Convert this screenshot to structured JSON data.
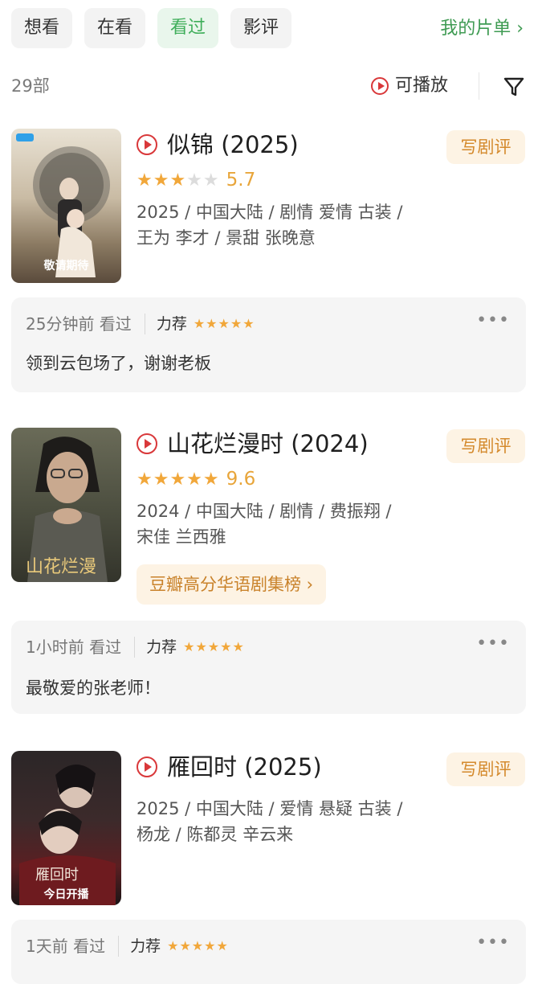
{
  "tabs": [
    {
      "label": "想看"
    },
    {
      "label": "在看"
    },
    {
      "label": "看过",
      "active": true
    },
    {
      "label": "影评"
    }
  ],
  "my_list_label": "我的片单 ›",
  "count_label": "29部",
  "playable_label": "可播放",
  "icons": {
    "play": "play-circle-icon",
    "filter": "funnel-icon",
    "more": "more-dots-icon"
  },
  "colors": {
    "accent_green": "#3fae5a",
    "play_red": "#d9383a",
    "star": "#f1a73a",
    "button_bg": "#fdf3e4",
    "button_text": "#d4892b"
  },
  "write_review_label": "写剧评",
  "items": [
    {
      "title": "似锦 (2025)",
      "rating_stars": 3,
      "score": "5.7",
      "meta_line1": "2025 / 中国大陆 / 剧情 爱情 古装 /",
      "meta_line2": "王为 李才 / 景甜 张晚意",
      "poster_caption": "敬请期待",
      "review": {
        "time": "25分钟前 看过",
        "tag": "力荐",
        "stars": "★★★★★",
        "text": "领到云包场了，谢谢老板"
      }
    },
    {
      "title": "山花烂漫时 (2024)",
      "rating_stars": 5,
      "score": "9.6",
      "meta_line1": "2024 / 中国大陆 / 剧情 / 费振翔 /",
      "meta_line2": "宋佳 兰西雅",
      "chart_label": "豆瓣高分华语剧集榜 ›",
      "review": {
        "time": "1小时前 看过",
        "tag": "力荐",
        "stars": "★★★★★",
        "text": "最敬爱的张老师！"
      }
    },
    {
      "title": "雁回时 (2025)",
      "meta_line1": "2025 / 中国大陆 / 爱情 悬疑 古装 /",
      "meta_line2": "杨龙 / 陈都灵 辛云来",
      "poster_caption": "今日开播",
      "review": {
        "time": "1天前 看过",
        "tag": "力荐",
        "stars": "★★★★★"
      }
    }
  ]
}
